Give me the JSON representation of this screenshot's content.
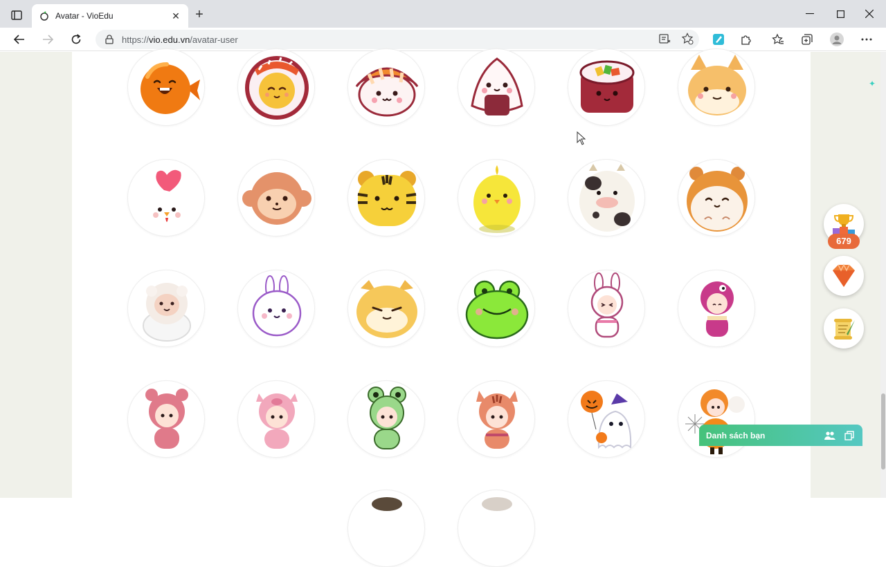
{
  "browser": {
    "tab_title": "Avatar - VioEdu",
    "url_prefix": "https://",
    "url_host": "vio.edu.vn",
    "url_path": "/avatar-user"
  },
  "avatars": [
    {
      "name": "orange-fish"
    },
    {
      "name": "sushi-salmon-roll"
    },
    {
      "name": "salmon-nigiri"
    },
    {
      "name": "onigiri"
    },
    {
      "name": "maki-roll"
    },
    {
      "name": "shiba-dog"
    },
    {
      "name": "chicken"
    },
    {
      "name": "monkey"
    },
    {
      "name": "tiger"
    },
    {
      "name": "chick"
    },
    {
      "name": "cow"
    },
    {
      "name": "hamster"
    },
    {
      "name": "sheep"
    },
    {
      "name": "bunny"
    },
    {
      "name": "shiba-cat"
    },
    {
      "name": "frog"
    },
    {
      "name": "kid-bunny-costume"
    },
    {
      "name": "kid-bird-costume"
    },
    {
      "name": "kid-bear-costume"
    },
    {
      "name": "kid-pig-costume"
    },
    {
      "name": "kid-frog-costume"
    },
    {
      "name": "kid-tiger-costume"
    },
    {
      "name": "halloween-ghost"
    },
    {
      "name": "halloween-pumpkin-kid"
    }
  ],
  "sidebar": {
    "gem_count": "679"
  },
  "friends": {
    "label": "Danh sách bạn"
  },
  "colors": {
    "accent_green": "#46c27a",
    "accent_teal": "#55c8c2",
    "gem_badge": "#e86a3a"
  }
}
